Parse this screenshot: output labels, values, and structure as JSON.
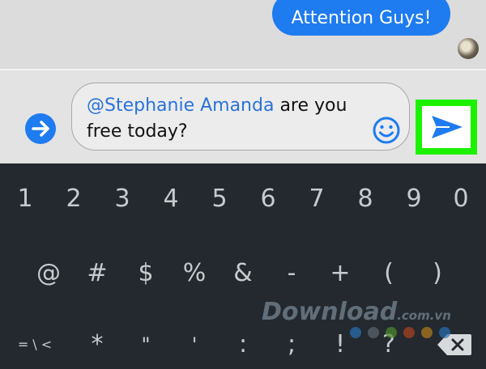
{
  "chat": {
    "outgoing_message": "Attention Guys!",
    "bubble_color": "#1e7bf0"
  },
  "composer": {
    "mention": "@Stephanie Amanda",
    "message_rest": " are you free today?",
    "expand_icon": "arrow-right-circle-icon",
    "emoji_icon": "smiley-icon",
    "send_icon": "paper-plane-send-icon",
    "highlight_color": "#1cf100"
  },
  "keyboard": {
    "row1": [
      "1",
      "2",
      "3",
      "4",
      "5",
      "6",
      "7",
      "8",
      "9",
      "0"
    ],
    "row2": [
      "@",
      "#",
      "$",
      "%",
      "&",
      "-",
      "+",
      "(",
      ")"
    ],
    "row3": [
      "= \\ <",
      "*",
      "\"",
      "'",
      ":",
      ";",
      "!",
      "?"
    ],
    "backspace_icon": "backspace-icon"
  },
  "watermark": {
    "brand": "Download",
    "tld": ".com.vn"
  }
}
